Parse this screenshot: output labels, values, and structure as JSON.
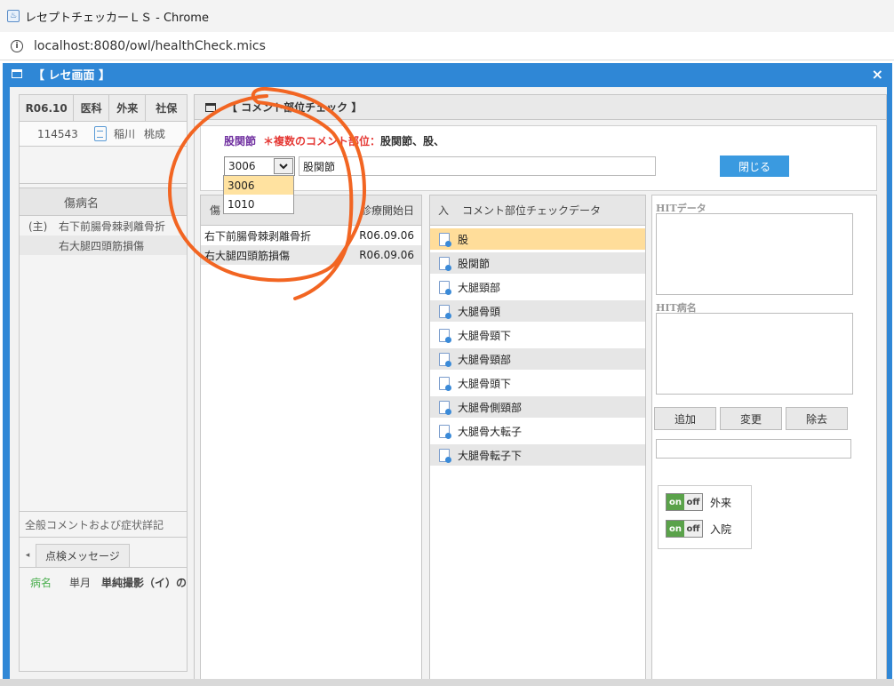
{
  "browser": {
    "title": "レセプトチェッカーＬＳ - Chrome",
    "url": "localhost:8080/owl/healthCheck.mics"
  },
  "dialog": {
    "title": "【 レセ画面 】",
    "close": "×"
  },
  "left_panel": {
    "header": [
      "R06.10",
      "医科",
      "外来",
      "社保"
    ],
    "patient_id": "114543",
    "patient_name_1": "稲川",
    "patient_name_2": "桃成",
    "dx_header": "傷病名",
    "dx_rows": [
      {
        "tag": "(主)",
        "name": "右下前腸骨棘剥離骨折"
      },
      {
        "tag": "",
        "name": "右大腿四頭筋損傷"
      }
    ],
    "general_comment": "全般コメントおよび症状詳記",
    "tab_arrow": "◂",
    "tab": "点検メッセージ",
    "msg_col1": "病名",
    "msg_col2": "単月",
    "msg_col3": "単純撮影（イ）の"
  },
  "comment_check": {
    "title": "【 コメント部位チェック 】",
    "part_label": "股関節",
    "multi_label": "＊複数のコメント部位：",
    "multi_value": "股関節、股、",
    "code_value": "3006",
    "name_value": "股関節",
    "close_button": "閉じる",
    "dropdown_options": [
      "3006",
      "1010"
    ],
    "dx_header_name": "傷",
    "dx_header_date": "診療開始日",
    "dx_rows": [
      {
        "name": "右下前腸骨棘剥離骨折",
        "date": "R06.09.06"
      },
      {
        "name": "右大腿四頭筋損傷",
        "date": "R06.09.06"
      }
    ],
    "cp_header_in": "入",
    "cp_header_label": "コメント部位チェックデータ",
    "cp_rows": [
      "股",
      "股関節",
      "大腿頸部",
      "大腿骨頭",
      "大腿骨頸下",
      "大腿骨頸部",
      "大腿骨頭下",
      "大腿骨側頸部",
      "大腿骨大転子",
      "大腿骨転子下"
    ],
    "hit_data_label": "HITデータ",
    "hit_dx_label": "HIT病名",
    "btn_add": "追加",
    "btn_change": "変更",
    "btn_remove": "除去",
    "toggle_on": "on",
    "toggle_off": "off",
    "toggle_outpatient": "外来",
    "toggle_inpatient": "入院"
  },
  "colors": {
    "dialog_blue": "#2f87d6",
    "highlight": "#ffdd9a",
    "annotation": "#f26522",
    "purple": "#7030a0",
    "red": "#e53935"
  }
}
